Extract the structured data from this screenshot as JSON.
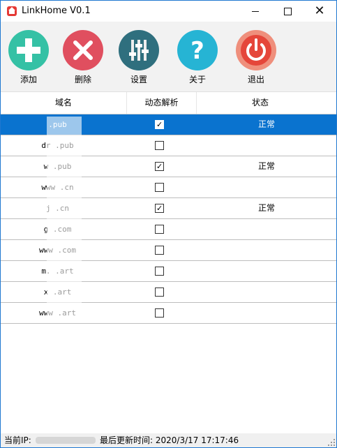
{
  "window": {
    "title": "LinkHome V0.1",
    "controls": {
      "minimize": "minimize",
      "maximize": "maximize",
      "close": "✕"
    }
  },
  "toolbar": {
    "items": [
      {
        "label": "添加",
        "icon": "plus-icon"
      },
      {
        "label": "删除",
        "icon": "x-icon"
      },
      {
        "label": "设置",
        "icon": "sliders-icon"
      },
      {
        "label": "关于",
        "icon": "question-icon"
      },
      {
        "label": "退出",
        "icon": "power-icon"
      }
    ]
  },
  "table": {
    "columns": [
      "域名",
      "动态解析",
      "状态"
    ],
    "rows": [
      {
        "domain": "    .pub",
        "dynamic": true,
        "status": "正常",
        "selected": true
      },
      {
        "domain": "dr  .pub",
        "dynamic": false,
        "status": ""
      },
      {
        "domain": "w   .pub",
        "dynamic": true,
        "status": "正常"
      },
      {
        "domain": "www .cn",
        "dynamic": false,
        "status": ""
      },
      {
        "domain": "j   .cn",
        "dynamic": true,
        "status": "正常"
      },
      {
        "domain": "g   .com",
        "dynamic": false,
        "status": ""
      },
      {
        "domain": "www .com",
        "dynamic": false,
        "status": ""
      },
      {
        "domain": "m.  .art",
        "dynamic": false,
        "status": ""
      },
      {
        "domain": "x   .art",
        "dynamic": false,
        "status": ""
      },
      {
        "domain": "www .art",
        "dynamic": false,
        "status": ""
      }
    ]
  },
  "statusbar": {
    "ip_label": "当前IP:",
    "updated_text": "最后更新时间: 2020/3/17 17:17:46"
  },
  "colors": {
    "selection": "#0a73cf",
    "add": "#35c1a5",
    "delete": "#e04f5f",
    "settings": "#2f6f7e",
    "about": "#26b4d4",
    "exit": "#ef8f7c"
  }
}
